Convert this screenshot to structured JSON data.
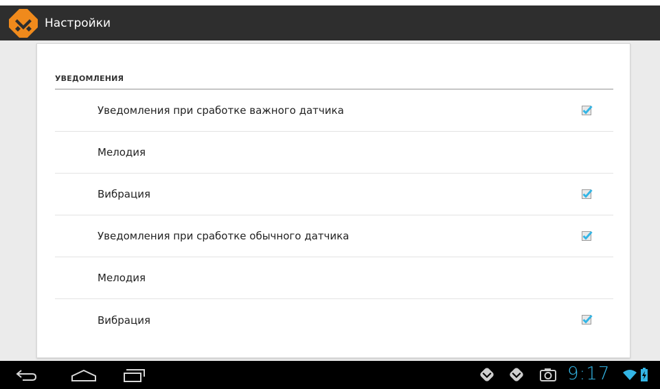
{
  "app": {
    "title": "Настройки",
    "logo_icon": "app-logo-icon"
  },
  "colors": {
    "accent": "#33b5e5",
    "actionbar": "#2e2e2e",
    "navbar": "#000000",
    "card": "#ffffff",
    "background": "#ebebeb"
  },
  "settings": {
    "section_title": "УВЕДОМЛЕНИЯ",
    "items": [
      {
        "label": "Уведомления при сработке важного датчика",
        "has_checkbox": true,
        "checked": true
      },
      {
        "label": "Мелодия",
        "has_checkbox": false
      },
      {
        "label": "Вибрация",
        "has_checkbox": true,
        "checked": true
      },
      {
        "label": "Уведомления при сработке обычного датчика",
        "has_checkbox": true,
        "checked": true
      },
      {
        "label": "Мелодия",
        "has_checkbox": false
      },
      {
        "label": "Вибрация",
        "has_checkbox": true,
        "checked": true
      }
    ]
  },
  "navbar": {
    "buttons": [
      "back-icon",
      "home-icon",
      "recent-apps-icon"
    ],
    "status": {
      "icons": [
        "app-notification-icon",
        "app-notification-icon",
        "screenshot-icon",
        "wifi-icon",
        "battery-charging-icon"
      ],
      "clock": "9:17"
    }
  }
}
